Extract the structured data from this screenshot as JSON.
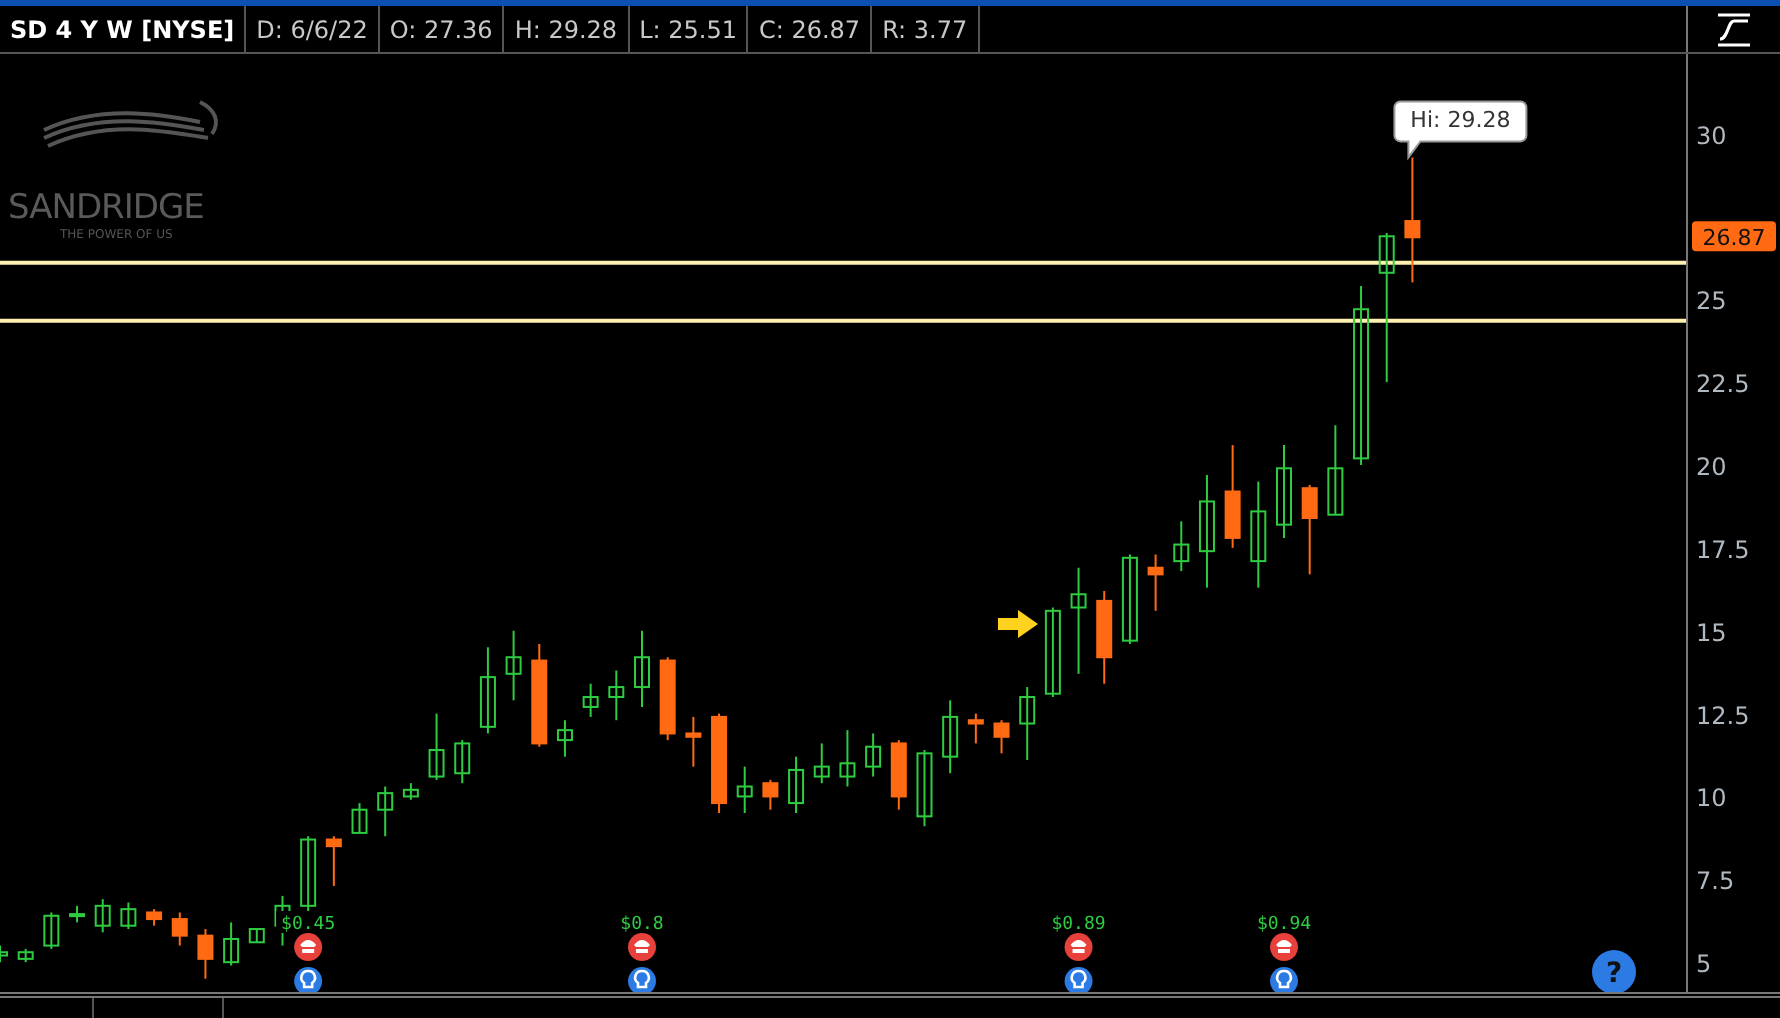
{
  "header": {
    "symbol": "SD 4 Y W [NYSE]",
    "fields": [
      "D: 6/6/22",
      "O: 27.36",
      "H: 29.28",
      "L: 25.51",
      "C: 26.87",
      "R: 3.77"
    ]
  },
  "logo": {
    "name": "SANDRIDGE",
    "tagline": "THE POWER OF US"
  },
  "chart": {
    "high_label": "Hi: 29.28",
    "price_tag": "26.87",
    "help": "?",
    "axis_labels": [
      "30",
      "25",
      "22.5",
      "20",
      "17.5",
      "15",
      "12.5",
      "10",
      "7.5",
      "5"
    ],
    "dividends": [
      {
        "label": "$0.45"
      },
      {
        "label": "$0.8"
      },
      {
        "label": "$0.89"
      },
      {
        "label": "$0.94"
      }
    ]
  }
}
